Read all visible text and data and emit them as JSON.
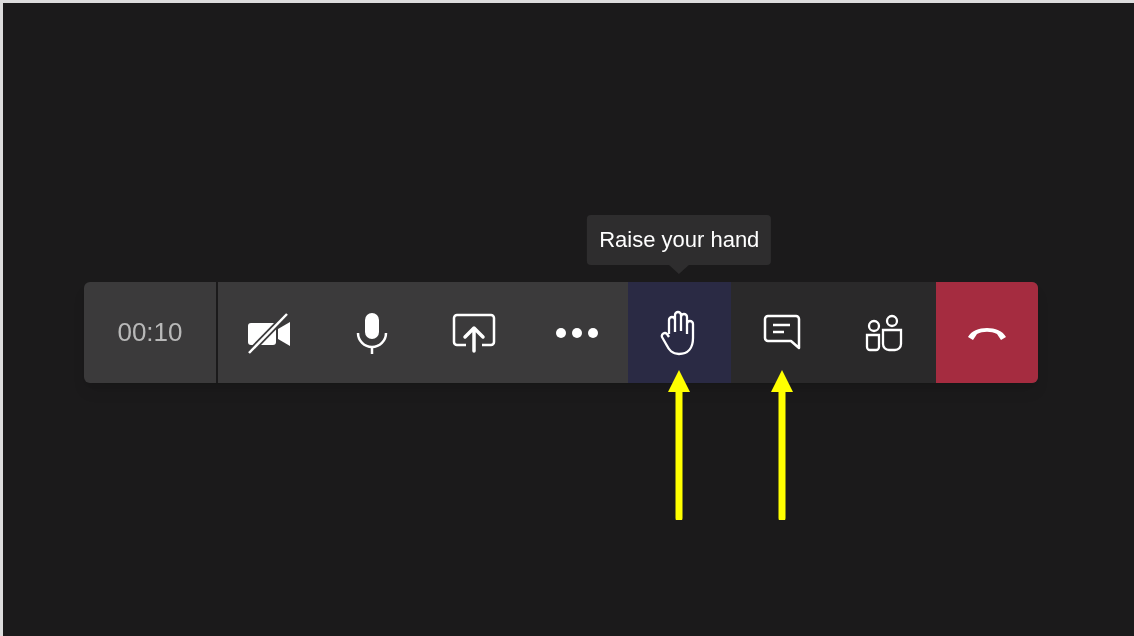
{
  "call_bar": {
    "timer": "00:10",
    "buttons": [
      {
        "kind": "video_off",
        "selected": false,
        "annotated": false
      },
      {
        "kind": "mic",
        "selected": false,
        "annotated": false
      },
      {
        "kind": "share",
        "selected": false,
        "annotated": false
      },
      {
        "kind": "more",
        "selected": false,
        "annotated": false
      },
      {
        "kind": "hand",
        "selected": true,
        "annotated": true,
        "tooltip": "Raise your hand"
      },
      {
        "kind": "chat",
        "selected": false,
        "annotated": true
      },
      {
        "kind": "people",
        "selected": false,
        "annotated": false
      },
      {
        "kind": "hang_up",
        "selected": false,
        "annotated": false
      }
    ]
  }
}
